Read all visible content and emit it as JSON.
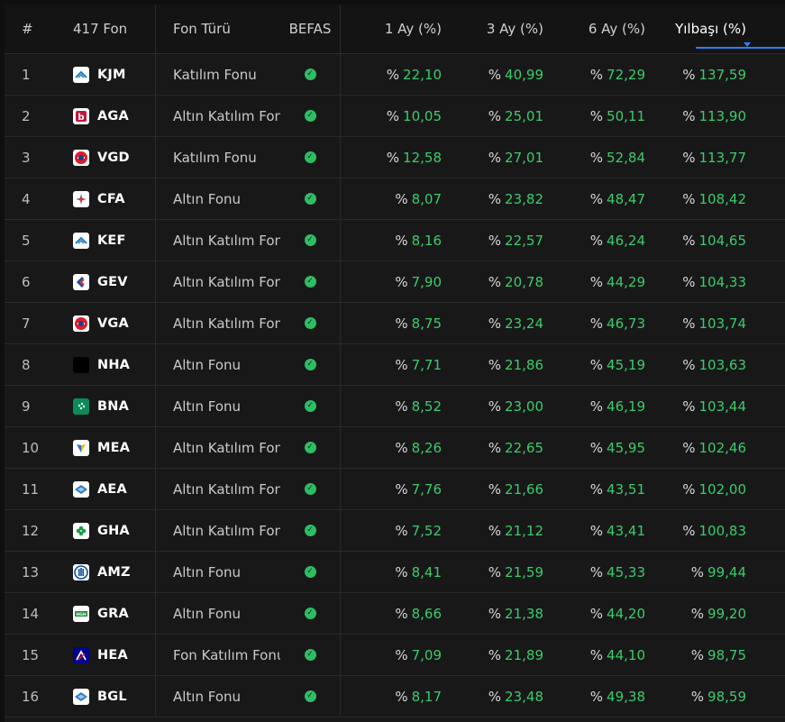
{
  "header": {
    "index": "#",
    "fund": "417 Fon",
    "type": "Fon Türü",
    "befas": "BEFAS",
    "m1": "1 Ay (%)",
    "m3": "3 Ay (%)",
    "m6": "6 Ay (%)",
    "ytd": "Yılbaşı (%)"
  },
  "colors": {
    "accent": "#2d7ff9",
    "positive": "#3ccb6a",
    "check": "#2ebd64"
  },
  "percent_sign": "%",
  "rows": [
    {
      "idx": "1",
      "code": "KJM",
      "type": "Katılım Fonu",
      "logo": "kuveytturk-logo",
      "m1": "22,10",
      "m3": "40,99",
      "m6": "72,29",
      "ytd": "137,59"
    },
    {
      "idx": "2",
      "code": "AGA",
      "type": "Altın Katılım Fonu",
      "logo": "albaraka-logo",
      "m1": "10,05",
      "m3": "25,01",
      "m6": "50,11",
      "ytd": "113,90"
    },
    {
      "idx": "3",
      "code": "VGD",
      "type": "Katılım Fonu",
      "logo": "vakif-logo",
      "m1": "12,58",
      "m3": "27,01",
      "m6": "52,84",
      "ytd": "113,77"
    },
    {
      "idx": "4",
      "code": "CFA",
      "type": "Altın Fonu",
      "logo": "burgan-logo",
      "m1": "8,07",
      "m3": "23,82",
      "m6": "48,47",
      "ytd": "108,42"
    },
    {
      "idx": "5",
      "code": "KEF",
      "type": "Altın Katılım Fonu",
      "logo": "kuveytturk-logo",
      "m1": "8,16",
      "m3": "22,57",
      "m6": "46,24",
      "ytd": "104,65"
    },
    {
      "idx": "6",
      "code": "GEV",
      "type": "Altın Katılım Fonu",
      "logo": "emlak-logo",
      "m1": "7,90",
      "m3": "20,78",
      "m6": "44,29",
      "ytd": "104,33"
    },
    {
      "idx": "7",
      "code": "VGA",
      "type": "Altın Katılım Fonu",
      "logo": "vakif-logo",
      "m1": "8,75",
      "m3": "23,24",
      "m6": "46,73",
      "ytd": "103,74"
    },
    {
      "idx": "8",
      "code": "NHA",
      "type": "Altın Fonu",
      "logo": "black-square-logo",
      "m1": "7,71",
      "m3": "21,86",
      "m6": "45,19",
      "ytd": "103,63"
    },
    {
      "idx": "9",
      "code": "BNA",
      "type": "Altın Fonu",
      "logo": "bnp-logo",
      "m1": "8,52",
      "m3": "23,00",
      "m6": "46,19",
      "ytd": "103,44"
    },
    {
      "idx": "10",
      "code": "MEA",
      "type": "Altın Katılım Fonu",
      "logo": "meta-logo",
      "m1": "8,26",
      "m3": "22,65",
      "m6": "45,95",
      "ytd": "102,46"
    },
    {
      "idx": "11",
      "code": "AEA",
      "type": "Altın Katılım Fonu",
      "logo": "ak-logo",
      "m1": "7,76",
      "m3": "21,66",
      "m6": "43,51",
      "ytd": "102,00"
    },
    {
      "idx": "12",
      "code": "GHA",
      "type": "Altın Katılım Fonu",
      "logo": "clover-logo",
      "m1": "7,52",
      "m3": "21,12",
      "m6": "43,41",
      "ytd": "100,83"
    },
    {
      "idx": "13",
      "code": "AMZ",
      "type": "Altın Fonu",
      "logo": "allianz-logo",
      "m1": "8,41",
      "m3": "21,59",
      "m6": "45,33",
      "ytd": "99,44"
    },
    {
      "idx": "14",
      "code": "GRA",
      "type": "Altın Fonu",
      "logo": "green-badge-logo",
      "m1": "8,66",
      "m3": "21,38",
      "m6": "44,20",
      "ytd": "99,20"
    },
    {
      "idx": "15",
      "code": "HEA",
      "type": "Fon Katılım Fonu",
      "logo": "axa-logo",
      "m1": "7,09",
      "m3": "21,89",
      "m6": "44,10",
      "ytd": "98,75"
    },
    {
      "idx": "16",
      "code": "BGL",
      "type": "Altın Fonu",
      "logo": "ak-logo",
      "m1": "8,17",
      "m3": "23,48",
      "m6": "49,38",
      "ytd": "98,59"
    }
  ]
}
